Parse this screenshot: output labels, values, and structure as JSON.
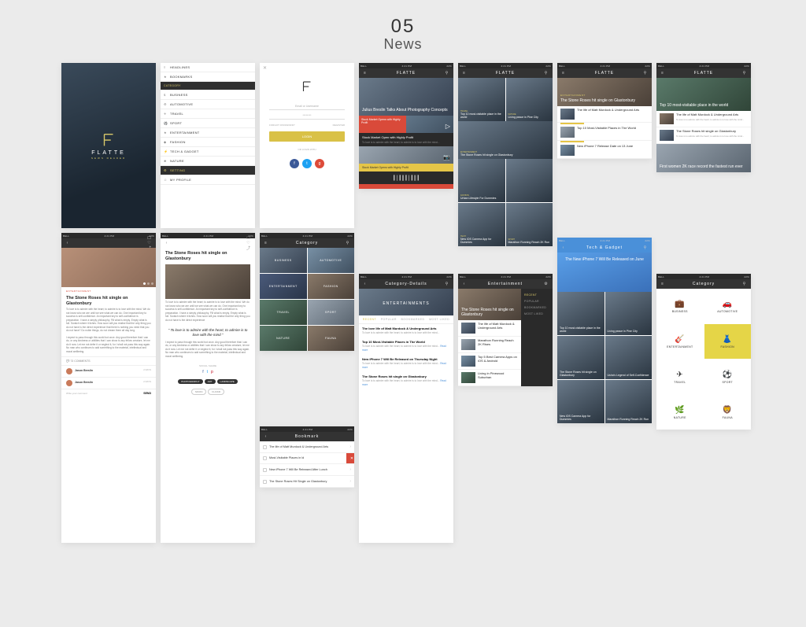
{
  "page": {
    "number": "05",
    "title": "News"
  },
  "status": {
    "carrier": "BELL",
    "time": "4:21 PM",
    "battery": "22%"
  },
  "brand": {
    "name": "FLATTE",
    "tagline": "NEWS READER"
  },
  "menu": {
    "headlines": "HEADLINES",
    "bookmarks": "BOOKMARKS",
    "category_label": "CATEGORY",
    "categories": [
      "BUSINESS",
      "AUTOMOTIVE",
      "TRAVEL",
      "SPORT",
      "ENTERTAINMENT",
      "FASHION",
      "TECH & GADGET",
      "NATURE"
    ],
    "setting": "SETTING",
    "profile": "MY PROFILE"
  },
  "login": {
    "placeholder_user": "Email or Username",
    "placeholder_pw": "********",
    "forgot": "FORGOT PASSWORD?",
    "register": "REGISTER",
    "login_btn": "LOGIN",
    "or": "OR LOGIN WITH"
  },
  "articles": {
    "stone_roses": "The Stone Roses hit single on Glastonbury",
    "julius": "Julius Breslin Talks About Photography Concepts",
    "stock": "Stock Market Open with Highly Profit",
    "stock_hl": "Stock Market Opens with Highly Profit",
    "top10": "Top 10 most-visitable place in the world",
    "top10_alt": "Top 10 Most-Visitable Places in The World",
    "living_peace": "Living peace in Pine City",
    "living_pinewood": "Living in Pinewood Suburban",
    "matt": "The life of Matt Murdock & Underground Arts",
    "matt_love": "The love life of Matt Murdock & Underground Arts",
    "iphone7": "New iPhone 7 Release Date on 13 June",
    "iphone7_thu": "New iPhone 7 Will Be Released on Thursday Night",
    "iphone7_lunch": "New iPhone 7 Will Be Released After Lunch",
    "iphone7_june": "The New iPhone 7 Will Be Released on June",
    "urban": "Urban Lifestyle For Dummies",
    "camera": "New iOS Camera App for Dummies",
    "camera_top": "Top 5 Best Camera Apps on iOS & Android",
    "marathon": "Marathon Running Reach 2K Run",
    "marathon_rises": "Marathon Running Reach 2K Rises",
    "first_women": "First women 2K race record the fastest run ever",
    "usha": "Usha's Legend of Self-Confidence"
  },
  "article_page": {
    "category": "ENTERTAINMENT",
    "body1": "To love is to admire with the heart; to admire is to love with the mind. We do not know who we are until we see what we can do. One important key to success is self-confidence. An important key to self-confidence is preparation. I have a simply philosophy. Fill what is empty. Empty what is full. Scratch where it itches. How soon will you realise that the only thing you do not have is the direct experience that there is nothing you need that you do not have? Do noble things, do not dream them all day long.",
    "body2": "I expect to pass through this world but once. Any good therefore that I can do, or any kindness or abilities that I can show to any fellow creature, let me do it now. Let me not defer it or neglect it, for I shall not pass this way again. No man who continues to add something to the material, intellectual and moral wellbeing.",
    "quote": "\" To love is to admire with the heart, to admire is to love with the mind \"",
    "comments_label": "73 COMMENTS",
    "commenter": "Jason Breslin",
    "comment_time": "2 DAYS",
    "share_label": "SOCIAL SHARE",
    "write": "Write your comment",
    "send": "SEND",
    "lipsum": "To love is to admire with the heart; to admire is to love with the mind. We do not know who we are until we see what we can do. One important key to success is self-confidence. An important key to self-confidence is preparation. I have a simply philosophy. Fill what is empty. Empty what is full. Scratch where it itches. How soon will you realise that the only thing you do not have is the direct experience",
    "lipsum_short": "To love is to admire with the heart; to admire is to love with the mind...",
    "readmore": "Read more"
  },
  "nav": {
    "category": "Category",
    "bookmark": "Bookmark",
    "entertainment": "Entertainment",
    "category_details": "Category-Details",
    "tech_gadget": "Tech & Gadget",
    "entertainments_hero": "ENTERTAINMENTS"
  },
  "tabs": {
    "recent": "RECENT",
    "popular": "POPULAR",
    "bookmarked": "BOOKMARKED",
    "mostliked": "MOST LIKED"
  },
  "filters": {
    "recent": "RECENT",
    "popular": "POPULAR",
    "bookmarked": "BOOKMARKED",
    "mostliked": "MOST LIKED"
  },
  "tags": {
    "t1": "PHOTOGRAPHY",
    "t2": "ART",
    "t3": "LANDSCAPE",
    "t4": "NIKON",
    "t5": "FLICKR"
  },
  "cat_labels": {
    "business": "BUSINESS",
    "automotive": "AUTOMOTIVE",
    "entertainment": "ENTERTAINMENT",
    "fashion": "FASHION",
    "travel": "TRAVEL",
    "sport": "SPORT",
    "nature": "NATURE",
    "fauna": "FAUNA"
  },
  "bookmarks": {
    "b1": "The life of Matt Murdock & Underground Arts",
    "b2": "Most-Visitable Places in ld",
    "b3": "New iPhone 7 Will Be Released After Lunch",
    "b4": "The Stone Roses Hit Single on Glastonbury"
  }
}
